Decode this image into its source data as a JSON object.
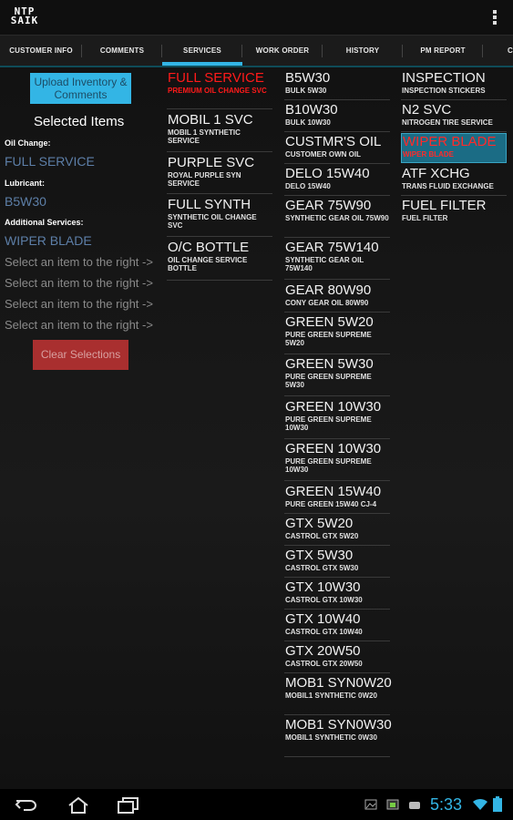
{
  "app": {
    "logo_top": "NTP",
    "logo_bottom": "SAIK"
  },
  "tabs": [
    {
      "label": "CUSTOMER INFO"
    },
    {
      "label": "COMMENTS"
    },
    {
      "label": "SERVICES"
    },
    {
      "label": "WORK ORDER"
    },
    {
      "label": "HISTORY"
    },
    {
      "label": "PM REPORT"
    },
    {
      "label": "C"
    }
  ],
  "left": {
    "upload_label": "Upload Inventory & Comments",
    "selected_title": "Selected Items",
    "oil_change_label": "Oil Change:",
    "oil_change_value": "FULL SERVICE",
    "lubricant_label": "Lubricant:",
    "lubricant_value": "B5W30",
    "additional_label": "Additional Services:",
    "additional_value": "WIPER BLADE",
    "placeholders": [
      "Select an item to the right ->",
      "Select an item to the right ->",
      "Select an item to the right ->",
      "Select an item to the right ->"
    ],
    "clear_label": "Clear Selections"
  },
  "oil_changes": [
    {
      "title": "FULL SERVICE",
      "sub": "PREMIUM OIL CHANGE SVC",
      "state": "selected"
    },
    {
      "title": "MOBIL 1 SVC",
      "sub": "MOBIL 1 SYNTHETIC SERVICE"
    },
    {
      "title": "PURPLE SVC",
      "sub": "ROYAL PURPLE SYN SERVICE"
    },
    {
      "title": "FULL SYNTH",
      "sub": "SYNTHETIC OIL CHANGE SVC"
    },
    {
      "title": "O/C BOTTLE",
      "sub": "OIL CHANGE SERVICE BOTTLE"
    }
  ],
  "lubricants": [
    {
      "title": "B5W30",
      "sub": "BULK 5W30"
    },
    {
      "title": "B10W30",
      "sub": "BULK 10W30"
    },
    {
      "title": "CUSTMR'S OIL",
      "sub": "CUSTOMER OWN OIL"
    },
    {
      "title": "DELO 15W40",
      "sub": "DELO 15W40"
    },
    {
      "title": "GEAR 75W90",
      "sub": "SYNTHETIC GEAR OIL 75W90"
    },
    {
      "title": "GEAR 75W140",
      "sub": "SYNTHETIC GEAR OIL 75W140"
    },
    {
      "title": "GEAR 80W90",
      "sub": "CONY GEAR OIL 80W90"
    },
    {
      "title": "GREEN 5W20",
      "sub": "PURE GREEN SUPREME 5W20"
    },
    {
      "title": "GREEN 5W30",
      "sub": "PURE GREEN SUPREME 5W30"
    },
    {
      "title": "GREEN 10W30",
      "sub": "PURE GREEN SUPREME 10W30"
    },
    {
      "title": "GREEN 10W30",
      "sub": "PURE GREEN SUPREME 10W30"
    },
    {
      "title": "GREEN 15W40",
      "sub": "PURE GREEN 15W40 CJ-4"
    },
    {
      "title": "GTX 5W20",
      "sub": "CASTROL GTX 5W20"
    },
    {
      "title": "GTX 5W30",
      "sub": "CASTROL GTX 5W30"
    },
    {
      "title": "GTX 10W30",
      "sub": "CASTROL GTX 10W30"
    },
    {
      "title": "GTX 10W40",
      "sub": "CASTROL GTX 10W40"
    },
    {
      "title": "GTX 20W50",
      "sub": "CASTROL GTX 20W50"
    },
    {
      "title": "MOB1 SYN0W20",
      "sub": "MOBIL1 SYNTHETIC 0W20"
    },
    {
      "title": "MOB1 SYN0W30",
      "sub": "MOBIL1 SYNTHETIC 0W30"
    }
  ],
  "additional": [
    {
      "title": "INSPECTION",
      "sub": "INSPECTION STICKERS"
    },
    {
      "title": "N2 SVC",
      "sub": "NITROGEN TIRE SERVICE"
    },
    {
      "title": "WIPER BLADE",
      "sub": "WIPER BLADE",
      "state": "highlighted"
    },
    {
      "title": "ATF XCHG",
      "sub": "TRANS FLUID EXCHANGE"
    },
    {
      "title": "FUEL FILTER",
      "sub": "FUEL FILTER"
    }
  ],
  "status": {
    "time": "5:33"
  },
  "colors": {
    "accent": "#33b5e5",
    "selected_text": "#ff1a1a",
    "clear_button": "#a92f2f",
    "value_text": "#5d7fa8"
  },
  "icons": {
    "nav": [
      "back-icon",
      "home-icon",
      "recent-apps-icon"
    ],
    "status": [
      "gallery-icon",
      "calendar-icon",
      "android-icon",
      "wifi-icon",
      "battery-icon"
    ]
  }
}
